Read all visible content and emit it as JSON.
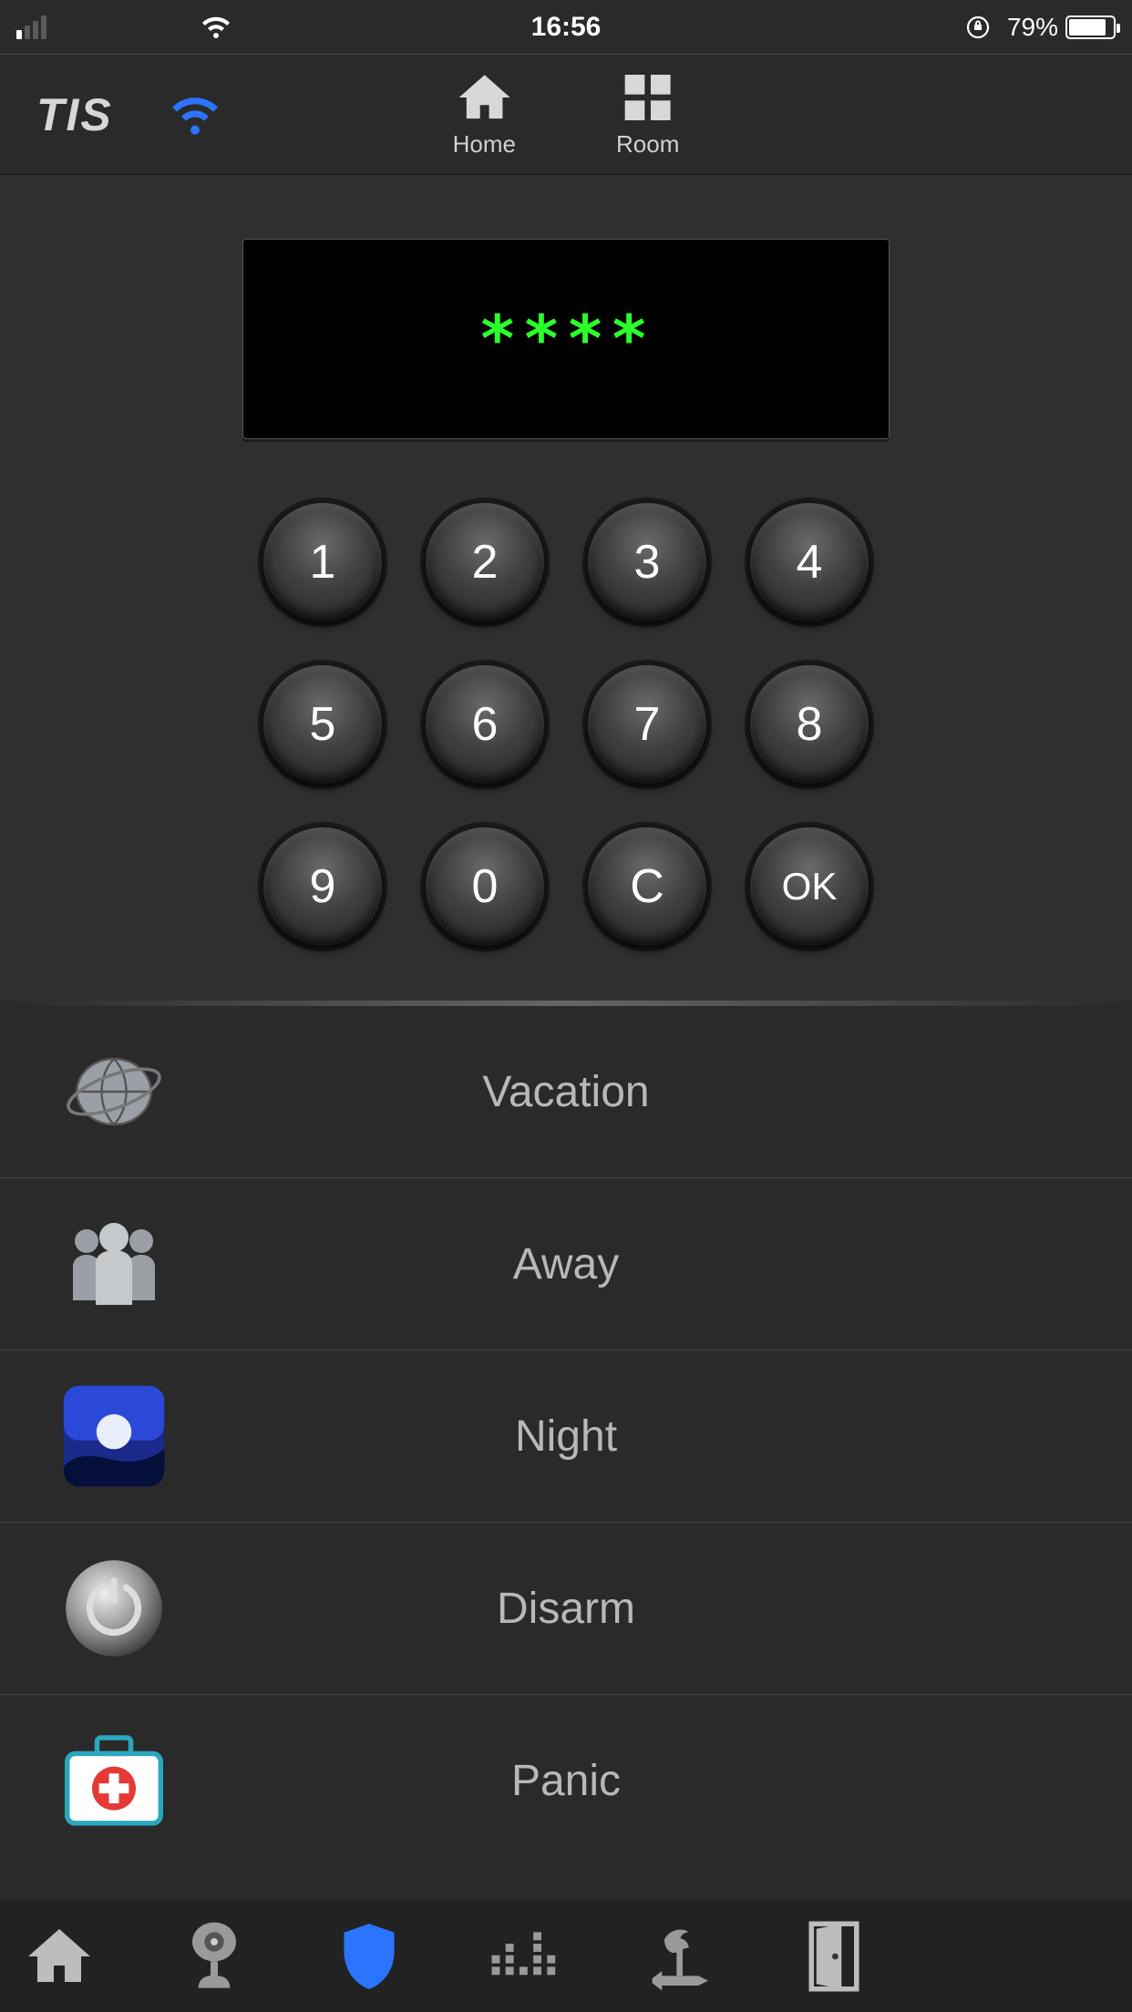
{
  "status_bar": {
    "time": "16:56",
    "battery_percent": "79%"
  },
  "header": {
    "brand": "TIS",
    "nav_home": "Home",
    "nav_room": "Room"
  },
  "keypad": {
    "display": "****",
    "keys": [
      "1",
      "2",
      "3",
      "4",
      "5",
      "6",
      "7",
      "8",
      "9",
      "0",
      "C",
      "OK"
    ]
  },
  "modes": [
    {
      "label": "Vacation",
      "icon": "globe"
    },
    {
      "label": "Away",
      "icon": "people"
    },
    {
      "label": "Night",
      "icon": "night"
    },
    {
      "label": "Disarm",
      "icon": "power"
    },
    {
      "label": "Panic",
      "icon": "medkit"
    }
  ],
  "tabs": [
    "home",
    "camera",
    "shield",
    "equalizer",
    "weather",
    "door"
  ]
}
